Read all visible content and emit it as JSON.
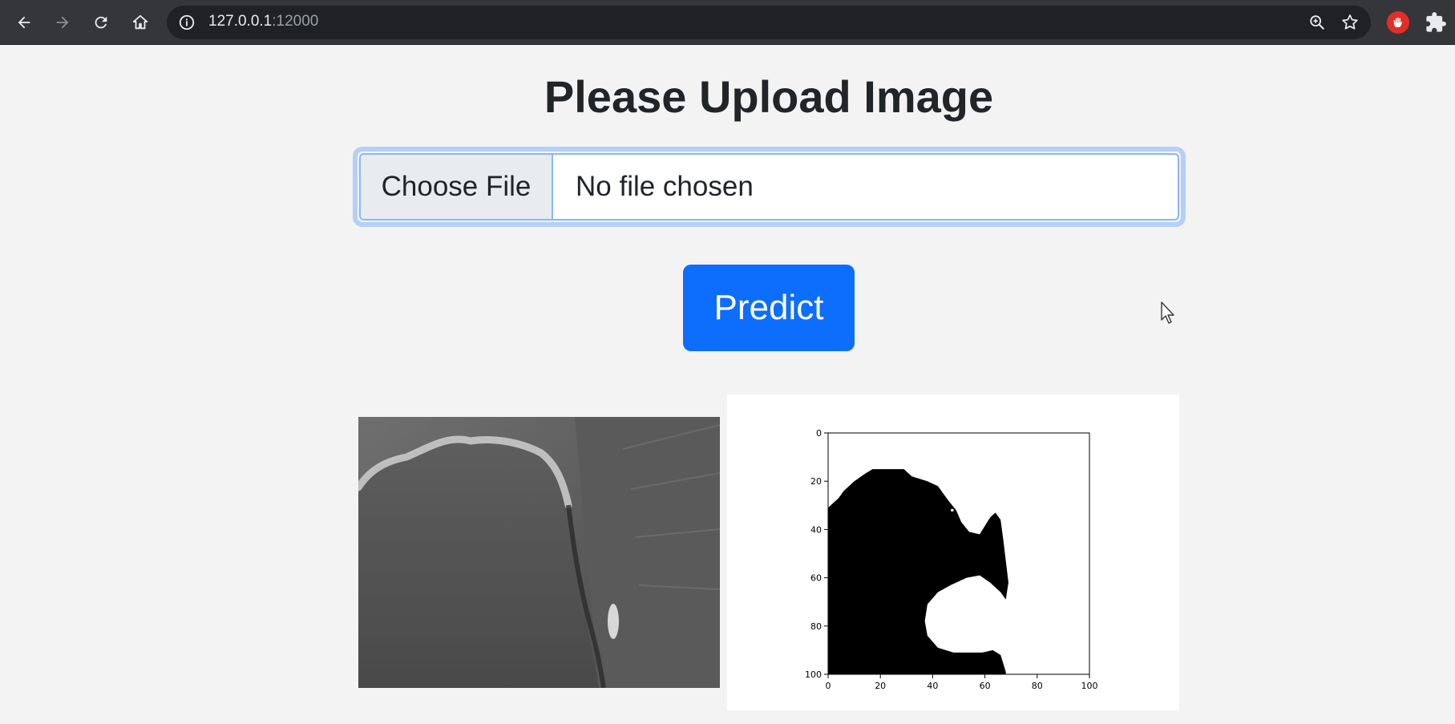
{
  "browser": {
    "url_host": "127.0.0.1",
    "url_port": ":12000",
    "icons": [
      "back-icon",
      "forward-icon",
      "reload-icon",
      "home-icon",
      "info-icon",
      "zoom-icon",
      "star-icon",
      "extension-hand-icon",
      "puzzle-icon"
    ]
  },
  "page": {
    "title": "Please Upload Image",
    "file_input": {
      "button_label": "Choose File",
      "status": "No file chosen"
    },
    "predict_label": "Predict"
  },
  "colors": {
    "primary": "#0d6efd",
    "focus_ring": "#b4d0f7",
    "page_bg": "#f3f3f4"
  },
  "chart_data": {
    "type": "heatmap",
    "description_free": true,
    "xticks": [
      0,
      20,
      40,
      60,
      80,
      100
    ],
    "yticks": [
      0,
      20,
      40,
      60,
      80,
      100
    ],
    "xlim": [
      0,
      100
    ],
    "ylim": [
      100,
      0
    ],
    "colormap": "binary",
    "mask_outline": [
      [
        0,
        31
      ],
      [
        2,
        29
      ],
      [
        4,
        27
      ],
      [
        6,
        24
      ],
      [
        10,
        20
      ],
      [
        14,
        17
      ],
      [
        17,
        15
      ],
      [
        29,
        15
      ],
      [
        32,
        18
      ],
      [
        38,
        20
      ],
      [
        42,
        22
      ],
      [
        46,
        28
      ],
      [
        49,
        32
      ],
      [
        51,
        37
      ],
      [
        54,
        41
      ],
      [
        58,
        42
      ],
      [
        62,
        35
      ],
      [
        64,
        33
      ],
      [
        66,
        36
      ],
      [
        67,
        44
      ],
      [
        68,
        53
      ],
      [
        69,
        62
      ],
      [
        68,
        69
      ],
      [
        66,
        66
      ],
      [
        62,
        62
      ],
      [
        58,
        59
      ],
      [
        53,
        60
      ],
      [
        47,
        63
      ],
      [
        42,
        66
      ],
      [
        38,
        71
      ],
      [
        37,
        78
      ],
      [
        38,
        84
      ],
      [
        42,
        89
      ],
      [
        48,
        91
      ],
      [
        59,
        91
      ],
      [
        63,
        90
      ],
      [
        66,
        92
      ],
      [
        68,
        99
      ],
      [
        68,
        100
      ],
      [
        0,
        100
      ]
    ],
    "mask_hole": [
      [
        47,
        31.5
      ],
      [
        48,
        31.5
      ],
      [
        48,
        32.5
      ],
      [
        47,
        32.5
      ]
    ]
  }
}
